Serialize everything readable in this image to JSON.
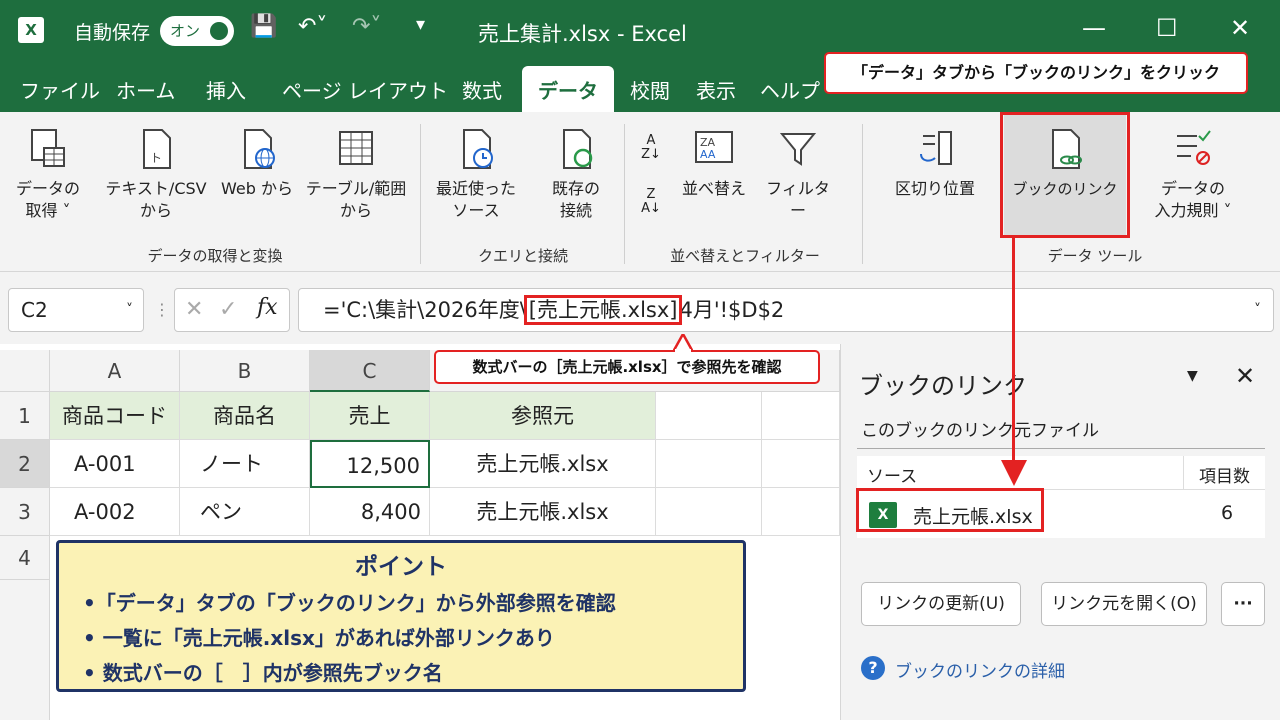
{
  "titlebar": {
    "autosave": "自動保存",
    "toggle": "オン",
    "doc_title": "売上集計.xlsx  -  Excel"
  },
  "tabs": [
    "ファイル",
    "ホーム",
    "挿入",
    "ページ レイアウト",
    "数式",
    "データ",
    "校閲",
    "表示",
    "ヘルプ"
  ],
  "callouts": {
    "top": "「データ」タブから「ブックのリンク」をクリック",
    "formula": "数式バーの［売上元帳.xlsx］で参照先を確認"
  },
  "ribbon": {
    "get_data": "データの\n取得 ˅",
    "text_csv": "テキスト/CSV\nから",
    "web": "Web から",
    "table_range": "テーブル/範囲\nから",
    "recent": "最近使った\nソース",
    "existing": "既存の\n接続",
    "sort": "並べ替え",
    "filter": "フィルター",
    "text_to_columns": "区切り位置",
    "book_links": "ブックのリンク",
    "validation": "データの\n入力規則 ˅",
    "group_get": "データの取得と変換",
    "group_query": "クエリと接続",
    "group_sort": "並べ替えとフィルター",
    "group_tools": "データ ツール"
  },
  "formula_bar": {
    "name_box": "C2",
    "formula_pre": "='C:\\集計\\2026年度\\",
    "formula_ref": "[売上元帳.xlsx]",
    "formula_post": "4月'!$D$2"
  },
  "sheet": {
    "columns": [
      "A",
      "B",
      "C"
    ],
    "rows": [
      "1",
      "2",
      "3",
      "4"
    ],
    "header": [
      "商品コード",
      "商品名",
      "売上",
      "参照元"
    ],
    "data": [
      [
        "A-001",
        "ノート",
        "12,500",
        "売上元帳.xlsx"
      ],
      [
        "A-002",
        "ペン",
        "8,400",
        "売上元帳.xlsx"
      ]
    ]
  },
  "point": {
    "title": "ポイント",
    "items": [
      "•「データ」タブの「ブックのリンク」から外部参照を確認",
      "• 一覧に「売上元帳.xlsx」があれば外部リンクあり",
      "• 数式バーの［　］内が参照先ブック名"
    ]
  },
  "pane": {
    "title": "ブックのリンク",
    "subtitle": "このブックのリンク元ファイル",
    "col_source": "ソース",
    "col_count": "項目数",
    "file_name": "売上元帳.xlsx",
    "file_count": "6",
    "update_btn": "リンクの更新(U)",
    "open_btn": "リンク元を開く(O)",
    "more_btn": "···",
    "help_link": "ブックのリンクの詳細"
  },
  "colors": {
    "excel_green": "#1e6e3e",
    "annotation_red": "#e32222",
    "point_bg": "#fbf2b5",
    "point_text": "#1f3366"
  }
}
